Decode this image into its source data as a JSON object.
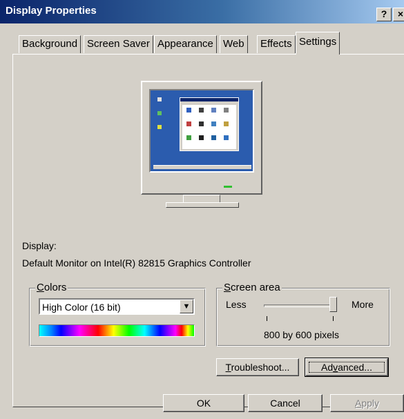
{
  "window": {
    "title": "Display Properties",
    "help_label": "?",
    "close_label": "×"
  },
  "tabs": [
    {
      "label": "Background"
    },
    {
      "label": "Screen Saver"
    },
    {
      "label": "Appearance"
    },
    {
      "label": "Web"
    },
    {
      "label": "Effects"
    },
    {
      "label": "Settings",
      "active": true
    }
  ],
  "display": {
    "label": "Display:",
    "value": "Default Monitor on Intel(R) 82815 Graphics Controller"
  },
  "colors": {
    "group_title_accel": "C",
    "group_title_rest": "olors",
    "selected": "High Color (16 bit)"
  },
  "screen_area": {
    "group_title_accel": "S",
    "group_title_rest": "creen area",
    "less_label": "Less",
    "more_label": "More",
    "value_text": "800 by 600 pixels",
    "slider_level": 1.0
  },
  "buttons": {
    "troubleshoot_accel": "T",
    "troubleshoot_rest": "roubleshoot...",
    "advanced_pre": "Ad",
    "advanced_accel": "v",
    "advanced_post": "anced...",
    "ok": "OK",
    "cancel": "Cancel",
    "apply_accel": "A",
    "apply_rest": "pply"
  },
  "colors_theme": {
    "titlebar_start": "#0a246a",
    "titlebar_end": "#a6caf0",
    "face": "#d4d0c8",
    "desktop": "#2b5cae"
  }
}
